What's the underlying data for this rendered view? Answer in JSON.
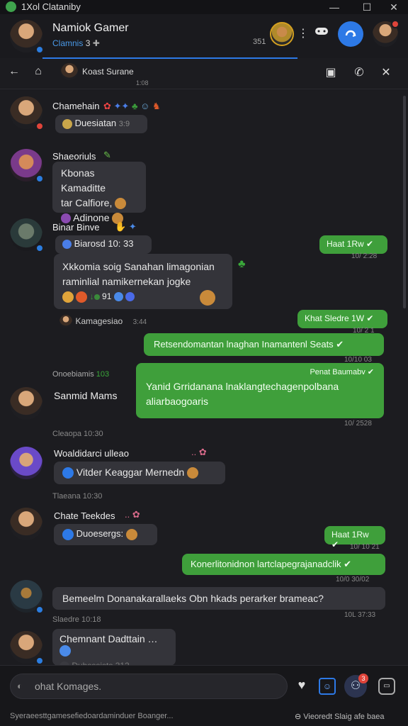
{
  "window": {
    "title": "1Xol Clataniby",
    "min": "—",
    "max": "☐",
    "close": "✕"
  },
  "header": {
    "user_name": "Namiok Gamer",
    "user_sub": "Clamnis",
    "sub_symbol": "3",
    "count": "351"
  },
  "subheader": {
    "title": "Koast Surane",
    "meta": "1:08"
  },
  "messages": [
    {
      "name": "Chamehain",
      "reply": "Duesiatan",
      "time": "3:9"
    },
    {
      "name": "Shaeoriuls",
      "lines": [
        "Kbonas Kamaditte",
        "tar Calfiore,",
        "Adinone"
      ]
    },
    {
      "name": "Binar Binve",
      "reply": "Biarosd 10: 33",
      "lines": [
        "Xkkomia soig Sanahan limagonian",
        "raminlial namikernekan jogke"
      ],
      "emoji_count": "91"
    },
    {
      "reply_name": "Kamagesiao",
      "reply_time": "3:44"
    },
    {
      "name": "Sanmid Mams",
      "pre": "Onoebiamis",
      "pre_num": "103"
    },
    {
      "time": "Cleaopa 10:30",
      "name": "Woaldidarci ulleao",
      "text": "Vitder Keaggar Mernedn"
    },
    {
      "time": "Tlaeana 10:30",
      "name": "Chate Teekdes",
      "text": "Duoesergs:"
    },
    {
      "text": "Bemeelm Donanakarallaeks Obn hkads perarker brameac?",
      "time": "10L 37:33"
    },
    {
      "time": "Slaedre 10:18",
      "name": "Chemnant Dadttain",
      "sub": "Dubsssists 312"
    }
  ],
  "outgoing": [
    {
      "text": "Haat 1Rw",
      "time": "10/ 2:28"
    },
    {
      "text": "Khat Sledre 1W",
      "time": "10/ 2 1"
    },
    {
      "text": "Retsendomantan lnaghan Inamantenl Seats",
      "time": "10/10 03"
    },
    {
      "head": "Penat Baumabv",
      "text": "Yanid Grridanana lnaklangtechagenpolbana aliarbaogoaris",
      "time": "10/ 2528"
    },
    {
      "text": "Haat 1Rw",
      "time": "10/ 10 21"
    },
    {
      "text": "Konerlitonidnon lartclapegrajanadclik",
      "time": "10/0 30/02"
    }
  ],
  "composer": {
    "placeholder": "ohat Komages.",
    "badge": "3"
  },
  "footer": {
    "left": "Syeraeesttgamesefiedoardaminduer Boanger...",
    "right": "Vieoredt Slaig afe baea"
  },
  "colors": {
    "accent": "#2d79e6",
    "outgoing": "#3f9f3b",
    "background": "#1c1c20"
  }
}
